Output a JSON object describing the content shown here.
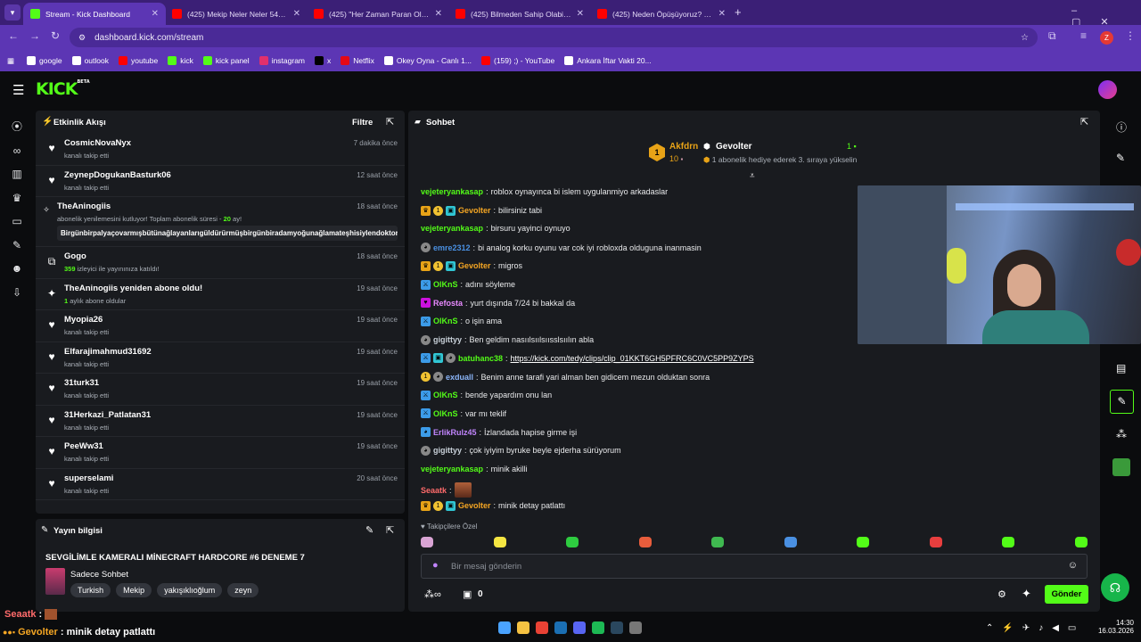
{
  "browser": {
    "tabs": [
      {
        "title": "Stream - Kick Dashboard",
        "favicon": "kick-icon",
        "color": "#53fc18",
        "active": true
      },
      {
        "title": "(425) Mekip Neler Neler 54.Bölü",
        "favicon": "youtube-icon",
        "color": "#ff0000",
        "active": false
      },
      {
        "title": "(425) \"Her Zaman Paran Olsun\"",
        "favicon": "youtube-icon",
        "color": "#ff0000",
        "active": false
      },
      {
        "title": "(425) Bilmeden Sahip Olabilecek",
        "favicon": "youtube-icon",
        "color": "#ff0000",
        "active": false
      },
      {
        "title": "(425) Neden Öpüşüyoruz? - You",
        "favicon": "youtube-icon",
        "color": "#ff0000",
        "active": false
      }
    ],
    "url": "dashboard.kick.com/stream",
    "profile_letter": "Z",
    "bookmarks": [
      {
        "label": "google",
        "icon": "google-icon",
        "color": "#ffffff"
      },
      {
        "label": "outlook",
        "icon": "outlook-icon",
        "color": "#ffffff"
      },
      {
        "label": "youtube",
        "icon": "youtube-icon",
        "color": "#ff0000"
      },
      {
        "label": "kick",
        "icon": "kick-icon",
        "color": "#53fc18"
      },
      {
        "label": "kick panel",
        "icon": "kick-icon",
        "color": "#53fc18"
      },
      {
        "label": "instagram",
        "icon": "instagram-icon",
        "color": "#e1306c"
      },
      {
        "label": "x",
        "icon": "x-icon",
        "color": "#000000"
      },
      {
        "label": "Netflix",
        "icon": "netflix-icon",
        "color": "#e50914"
      },
      {
        "label": "Okey Oyna - Canlı 1...",
        "icon": "okey-icon",
        "color": "#ffffff"
      },
      {
        "label": "(159) ;) - YouTube",
        "icon": "youtube-icon",
        "color": "#ff0000"
      },
      {
        "label": "Ankara İftar Vakti 20...",
        "icon": "ankara-icon",
        "color": "#ffffff"
      }
    ]
  },
  "kick": {
    "logo": "KICK",
    "beta": "BETA"
  },
  "activity": {
    "title": "Etkinlik Akışı",
    "filter_label": "Filtre",
    "items": [
      {
        "icon": "heart-icon",
        "name": "CosmicNovaNyx",
        "sub": "kanalı takip etti",
        "time": "7 dakika önce"
      },
      {
        "icon": "heart-icon",
        "name": "ZeynepDogukanBasturk06",
        "sub": "kanalı takip etti",
        "time": "12 saat önce"
      },
      {
        "icon": "sparkle-icon",
        "name": "TheAninogiis",
        "sub_pre": "abonelik yenilemesini kutluyor! Toplam abonelik süresi - ",
        "sub_num": "20",
        "sub_post": " ay!",
        "message": "Birgünbirpalyaçovarmışbütünağlayanlarıgüldürürmüşbirgünbiradamyoğunağlamateşhisiylendoktora",
        "time": "18 saat önce"
      },
      {
        "icon": "host-icon",
        "name": "Gogo",
        "sub_num": "359",
        "sub_post": " izleyici ile yayınınıza katıldı!",
        "time": "18 saat önce"
      },
      {
        "icon": "star-icon",
        "name": "TheAninogiis yeniden abone oldu!",
        "sub_num": "1",
        "sub_post": " aylık abone oldular",
        "time": "19 saat önce"
      },
      {
        "icon": "heart-icon",
        "name": "Myopia26",
        "sub": "kanalı takip etti",
        "time": "19 saat önce"
      },
      {
        "icon": "heart-icon",
        "name": "Elfarajimahmud31692",
        "sub": "kanalı takip etti",
        "time": "19 saat önce"
      },
      {
        "icon": "heart-icon",
        "name": "31turk31",
        "sub": "kanalı takip etti",
        "time": "19 saat önce"
      },
      {
        "icon": "heart-icon",
        "name": "31Herkazi_Patlatan31",
        "sub": "kanalı takip etti",
        "time": "19 saat önce"
      },
      {
        "icon": "heart-icon",
        "name": "PeeWw31",
        "sub": "kanalı takip etti",
        "time": "19 saat önce"
      },
      {
        "icon": "heart-icon",
        "name": "superselami",
        "sub": "kanalı takip etti",
        "time": "20 saat önce"
      }
    ]
  },
  "stream_info": {
    "title": "Yayın bilgisi",
    "stream_title": "SEVGİLİMLE KAMERALI MİNECRAFT HARDCORE #6 DENEME 7",
    "category": "Sadece Sohbet",
    "tags": [
      "Turkish",
      "Mekip",
      "yakışıklıoğlum",
      "zeyn"
    ]
  },
  "chat": {
    "title": "Sohbet",
    "pinned": {
      "rank": "1",
      "user": "Akfdrn",
      "count": "10",
      "target": "Gevolter",
      "target_count": "1",
      "message": "1 abonelik hediye ederek 3. sıraya yükselin"
    },
    "messages": [
      {
        "user": "vejeteryankasap",
        "color": "#53fc18",
        "badges": [],
        "text": "roblox oynayınca bi islem uygulanmiyo arkadaslar"
      },
      {
        "user": "Gevolter",
        "color": "#f5a623",
        "badges": [
          "crown",
          "sub",
          "gift"
        ],
        "text": "bilirsiniz tabi"
      },
      {
        "user": "vejeteryankasap",
        "color": "#53fc18",
        "badges": [],
        "text": "birsuru yayinci oynuyo"
      },
      {
        "user": "emre2312",
        "color": "#4a90e2",
        "badges": [
          "cat"
        ],
        "text": "bi analog korku oyunu var cok iyi robloxda olduguna inanmasin"
      },
      {
        "user": "Gevolter",
        "color": "#f5a623",
        "badges": [
          "crown",
          "sub",
          "gift"
        ],
        "text": "migros"
      },
      {
        "user": "OlKnS",
        "color": "#53fc18",
        "badges": [
          "mod"
        ],
        "text": "adını söyleme"
      },
      {
        "user": "Refosta",
        "color": "#e88aff",
        "badges": [
          "vip"
        ],
        "text": "yurt dışında 7/24 bi bakkal da"
      },
      {
        "user": "OlKnS",
        "color": "#53fc18",
        "badges": [
          "mod"
        ],
        "text": "o işin ama"
      },
      {
        "user": "gigittyy",
        "color": "#c9d1d9",
        "badges": [
          "cat"
        ],
        "text": "Ben geldim nasıılsıılsıısslsıılın abla"
      },
      {
        "user": "batuhanc38",
        "color": "#53fc18",
        "badges": [
          "mod",
          "gift",
          "cat"
        ],
        "text": "https://kick.com/tedy/clips/clip_01KKT6GH5PFRC6C0VC5PP9ZYPS",
        "link": true
      },
      {
        "user": "exduall",
        "color": "#8ab4f8",
        "badges": [
          "sub",
          "cat"
        ],
        "text": "Benim anne tarafi yari alman ben gidicem mezun olduktan sonra"
      },
      {
        "user": "OlKnS",
        "color": "#53fc18",
        "badges": [
          "mod"
        ],
        "text": "bende yapardım onu lan"
      },
      {
        "user": "OlKnS",
        "color": "#53fc18",
        "badges": [
          "mod"
        ],
        "text": "var mı teklif"
      },
      {
        "user": "ErlikRulz45",
        "color": "#c084fc",
        "badges": [
          "frog"
        ],
        "text": "İzlandada hapise girme işi"
      },
      {
        "user": "gigittyy",
        "color": "#c9d1d9",
        "badges": [
          "cat"
        ],
        "text": "çok iyiyim byruke beyle ejderha sürüyorum"
      },
      {
        "user": "vejeteryankasap",
        "color": "#53fc18",
        "badges": [],
        "text": "minik akilli"
      },
      {
        "user": "Seaatk",
        "color": "#ff6b6b",
        "badges": [],
        "text": "",
        "emote": true
      },
      {
        "user": "Gevolter",
        "color": "#f5a623",
        "badges": [
          "crown",
          "sub",
          "gift"
        ],
        "text": "minik detay patlattı"
      }
    ],
    "emote_section": "Takipçilere Özel",
    "input_placeholder": "Bir mesaj gönderin",
    "points": "0",
    "send_label": "Gönder"
  },
  "overlay": {
    "line1_user": "Seaatk",
    "line2_user": "Gevolter",
    "line2_text": "minik detay patlattı"
  },
  "taskbar": {
    "time": "14:30",
    "date": "16.03.2026"
  }
}
